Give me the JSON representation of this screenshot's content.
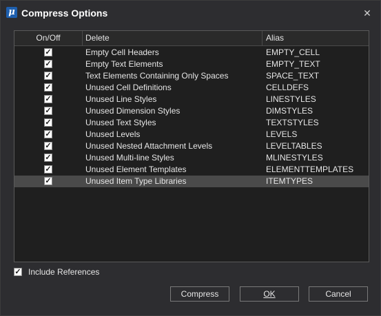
{
  "window": {
    "title": "Compress Options",
    "app_icon_glyph": "μ"
  },
  "table": {
    "headers": [
      "On/Off",
      "Delete",
      "Alias"
    ],
    "rows": [
      {
        "checked": true,
        "name": "Empty Cell Headers",
        "alias": "EMPTY_CELL"
      },
      {
        "checked": true,
        "name": "Empty Text Elements",
        "alias": "EMPTY_TEXT"
      },
      {
        "checked": true,
        "name": "Text Elements Containing Only Spaces",
        "alias": "SPACE_TEXT"
      },
      {
        "checked": true,
        "name": "Unused Cell Definitions",
        "alias": "CELLDEFS"
      },
      {
        "checked": true,
        "name": "Unused Line Styles",
        "alias": "LINESTYLES"
      },
      {
        "checked": true,
        "name": "Unused Dimension Styles",
        "alias": "DIMSTYLES"
      },
      {
        "checked": true,
        "name": "Unused Text Styles",
        "alias": "TEXTSTYLES"
      },
      {
        "checked": true,
        "name": "Unused Levels",
        "alias": "LEVELS"
      },
      {
        "checked": true,
        "name": "Unused Nested Attachment Levels",
        "alias": "LEVELTABLES"
      },
      {
        "checked": true,
        "name": "Unused Multi-line Styles",
        "alias": "MLINESTYLES"
      },
      {
        "checked": true,
        "name": "Unused Element Templates",
        "alias": "ELEMENTTEMPLATES"
      },
      {
        "checked": true,
        "name": "Unused Item Type Libraries",
        "alias": "ITEMTYPES",
        "selected": true
      }
    ]
  },
  "include_references": {
    "label": "Include References",
    "checked": true
  },
  "buttons": {
    "compress": "Compress",
    "ok": "OK",
    "cancel": "Cancel"
  },
  "icons": {
    "close": "close-icon",
    "check": "checkmark-icon",
    "app": "microstation-icon"
  },
  "colors": {
    "background": "#2d2d30",
    "table_bg": "#1f1f1f",
    "selected_row": "#4a4a4a",
    "app_icon": "#1e5fae"
  }
}
